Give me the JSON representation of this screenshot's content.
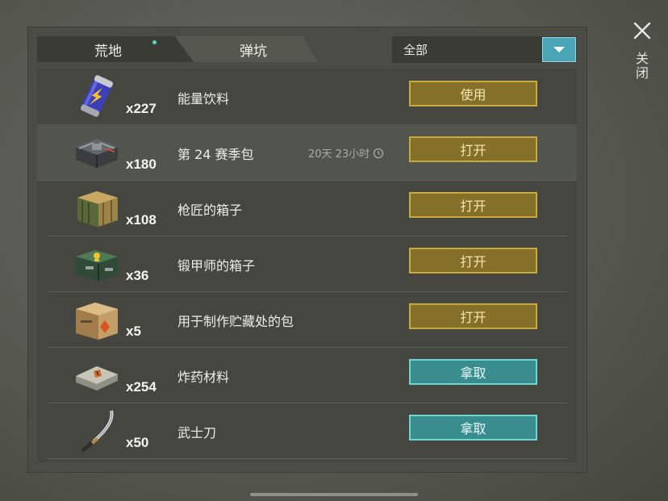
{
  "tabs": {
    "wasteland": "荒地",
    "crater": "弹坑"
  },
  "filter": {
    "selected": "全部"
  },
  "close_label": "关闭",
  "items": [
    {
      "name": "能量饮料",
      "count": "x227",
      "action": "使用",
      "action_style": "gold",
      "icon": "energy-drink-can-icon"
    },
    {
      "name": "第 24 赛季包",
      "count": "x180",
      "action": "打开",
      "action_style": "gold",
      "icon": "season-pack-icon",
      "timer": "20天 23小时"
    },
    {
      "name": "枪匠的箱子",
      "count": "x108",
      "action": "打开",
      "action_style": "gold",
      "icon": "wooden-crate-icon"
    },
    {
      "name": "锻甲师的箱子",
      "count": "x36",
      "action": "打开",
      "action_style": "gold",
      "icon": "green-chest-icon"
    },
    {
      "name": "用于制作贮藏处的包",
      "count": "x5",
      "action": "打开",
      "action_style": "gold",
      "icon": "cardboard-box-icon"
    },
    {
      "name": "炸药材料",
      "count": "x254",
      "action": "拿取",
      "action_style": "teal",
      "icon": "explosive-brick-icon"
    },
    {
      "name": "武士刀",
      "count": "x50",
      "action": "拿取",
      "action_style": "teal",
      "icon": "katana-icon"
    }
  ],
  "colors": {
    "accent_teal": "#4aa5b6",
    "gold_button": "#85702a",
    "teal_button": "#3a8d8e"
  }
}
